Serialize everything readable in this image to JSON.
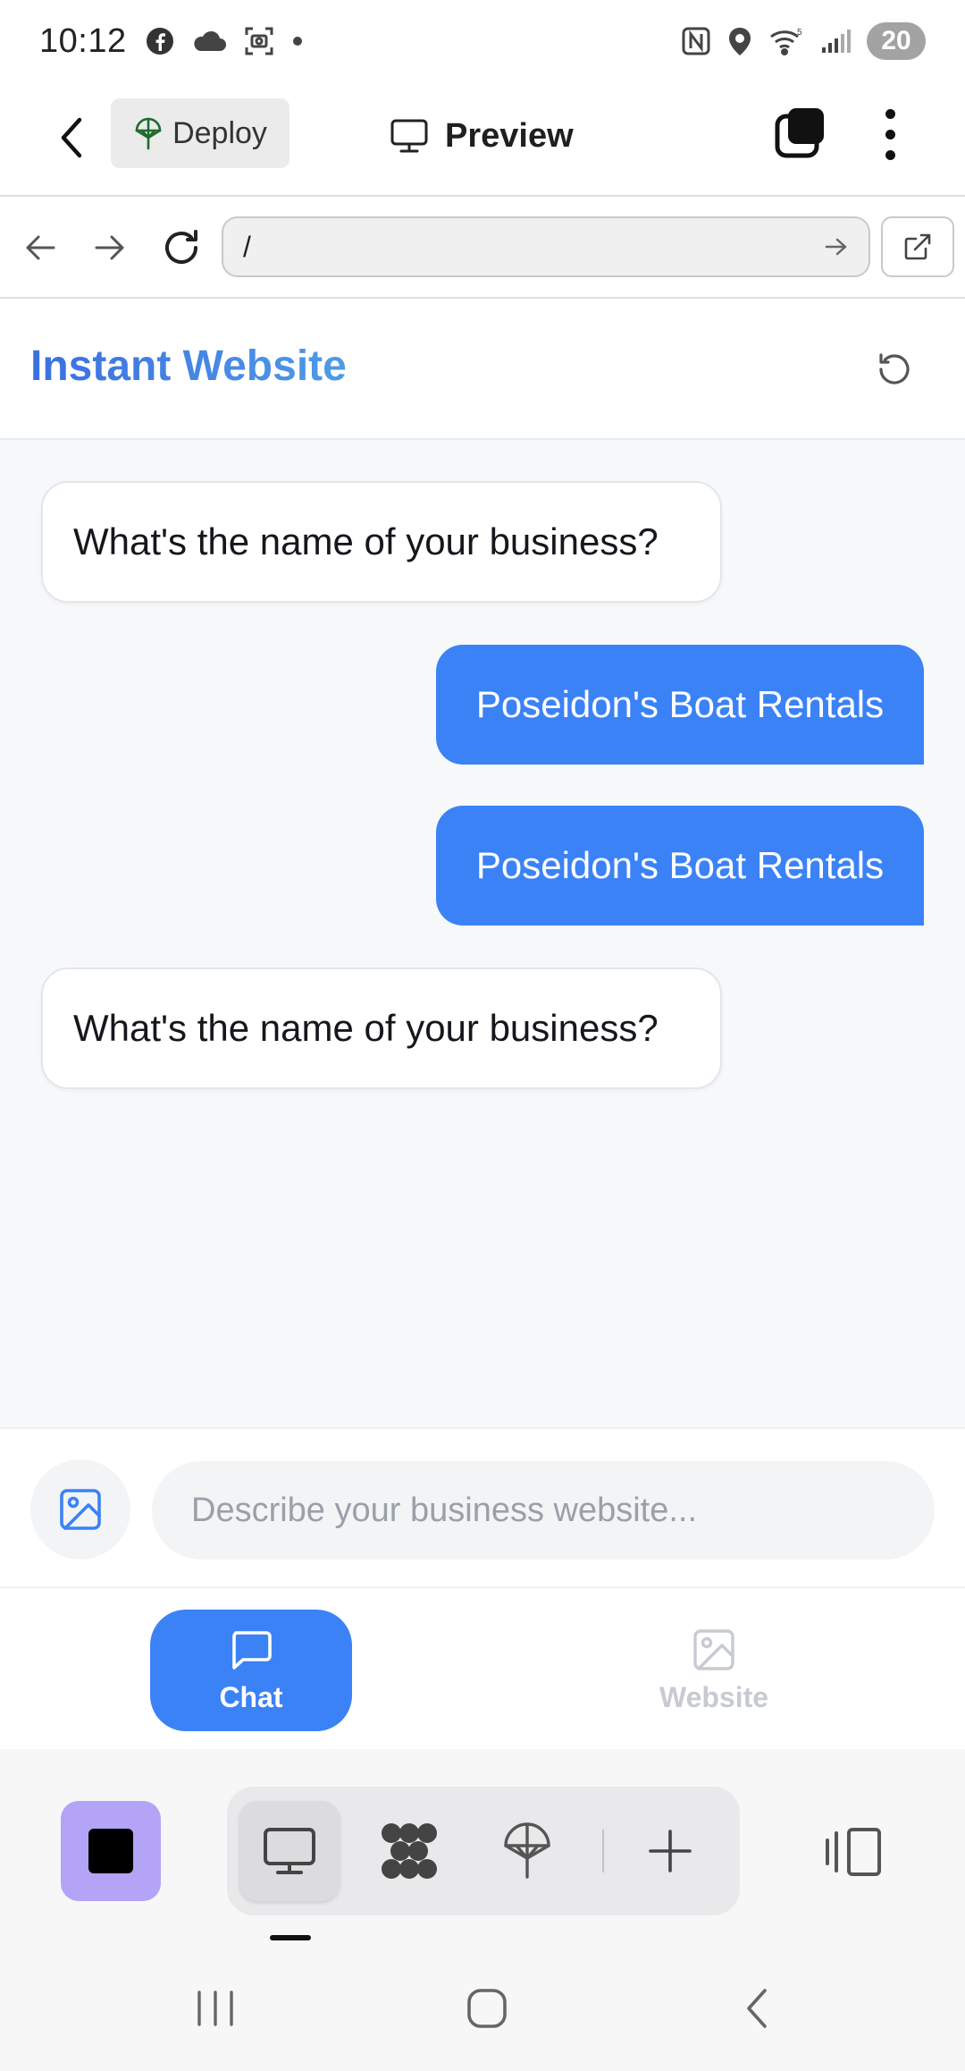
{
  "status_bar": {
    "time": "10:12",
    "battery": "20",
    "left_icons": [
      "facebook-icon",
      "cloud-icon",
      "screenshot-icon",
      "dot-icon"
    ],
    "right_icons": [
      "nfc-icon",
      "location-icon",
      "wifi-icon",
      "signal-icon"
    ]
  },
  "toolbar": {
    "deploy_label": "Deploy",
    "preview_label": "Preview"
  },
  "url_bar": {
    "url": "/"
  },
  "site": {
    "title": "Instant Website"
  },
  "chat": {
    "messages": [
      {
        "role": "bot",
        "text": "What's the name of your business?"
      },
      {
        "role": "user",
        "text": "Poseidon's Boat Rentals"
      },
      {
        "role": "user",
        "text": "Poseidon's Boat Rentals"
      },
      {
        "role": "bot",
        "text": "What's the name of your business?"
      }
    ]
  },
  "composer": {
    "placeholder": "Describe your business website..."
  },
  "app_tabs": {
    "chat_label": "Chat",
    "website_label": "Website",
    "active": "Chat"
  },
  "colors": {
    "accent": "#3b82f6",
    "user_bubble": "#3b82f6",
    "chat_background": "#f7f8fa",
    "home_button": "#b3a4f7"
  }
}
